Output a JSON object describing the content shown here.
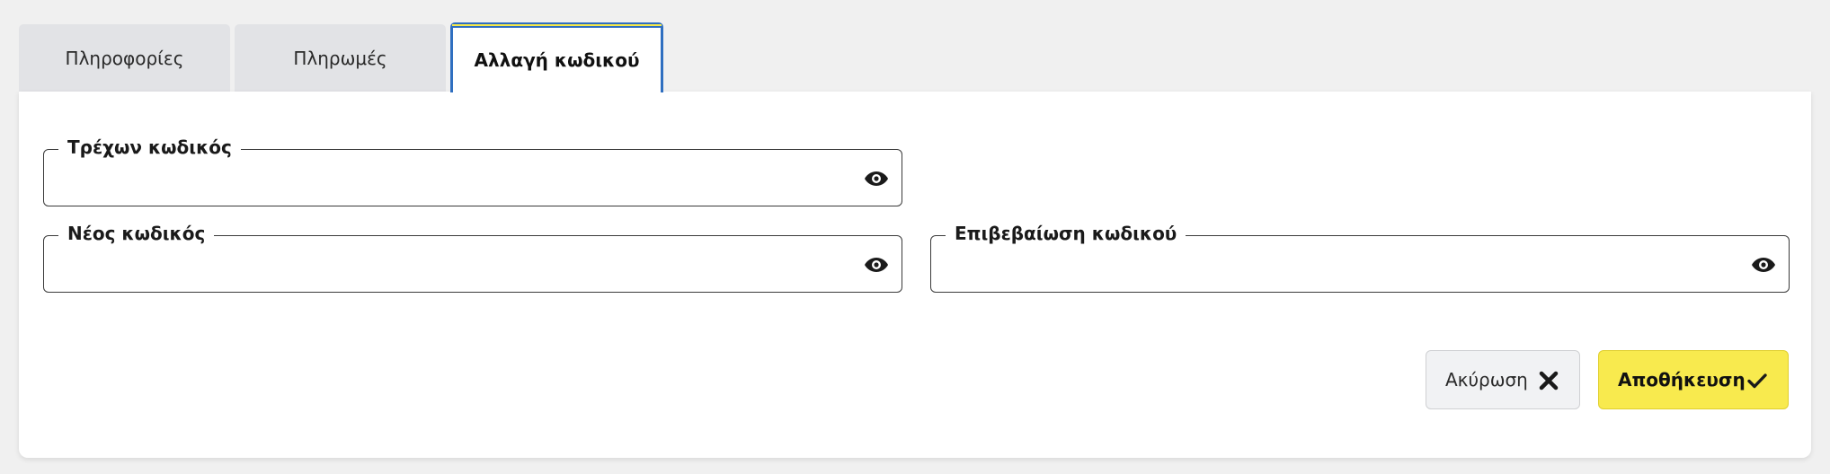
{
  "tabs": [
    {
      "label": "Πληροφορίες",
      "active": false
    },
    {
      "label": "Πληρωμές",
      "active": false
    },
    {
      "label": "Αλλαγή κωδικού",
      "active": true
    }
  ],
  "form": {
    "current_password": {
      "label": "Τρέχων κωδικός",
      "value": "",
      "icon": "eye-icon"
    },
    "new_password": {
      "label": "Νέος κωδικός",
      "value": "",
      "icon": "eye-icon"
    },
    "confirm_password": {
      "label": "Επιβεβαίωση κωδικού",
      "value": "",
      "icon": "eye-icon"
    }
  },
  "actions": {
    "cancel_label": "Ακύρωση",
    "cancel_icon": "close-icon",
    "save_label": "Αποθήκευση",
    "save_icon": "check-icon"
  },
  "colors": {
    "active_tab_border": "#2f6fc0",
    "active_tab_accent": "#f5e84a",
    "save_button": "#f8ea4e",
    "background": "#f0f0f0"
  }
}
